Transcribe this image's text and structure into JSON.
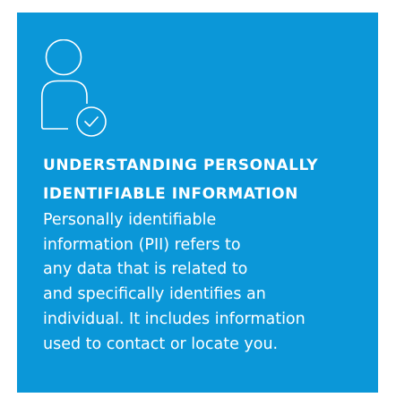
{
  "card": {
    "background": "#0b97d8",
    "icon": "person-check-icon",
    "heading_lines": [
      "UNDERSTANDING PERSONALLY",
      "IDENTIFIABLE INFORMATION"
    ],
    "body_lines": [
      "Personally identifiable",
      "information (PII) refers to",
      "any data that is related to",
      "and specifically identifies an",
      "individual. It includes information",
      "used to contact or locate you."
    ]
  }
}
